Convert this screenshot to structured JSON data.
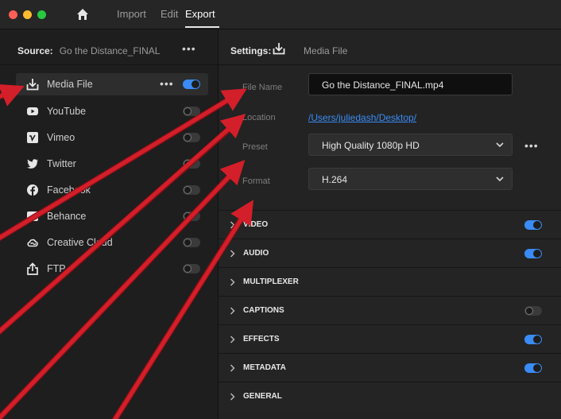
{
  "nav": {
    "tabs": [
      "Import",
      "Edit",
      "Export"
    ]
  },
  "source": {
    "label": "Source:",
    "value": "Go the Distance_FINAL",
    "more": "•••"
  },
  "destinations": [
    {
      "label": "Media File",
      "icon": "download-icon",
      "enabled": true,
      "selected": true,
      "more": "•••"
    },
    {
      "label": "YouTube",
      "icon": "youtube-icon",
      "enabled": false
    },
    {
      "label": "Vimeo",
      "icon": "vimeo-icon",
      "enabled": false
    },
    {
      "label": "Twitter",
      "icon": "twitter-icon",
      "enabled": false
    },
    {
      "label": "Facebook",
      "icon": "facebook-icon",
      "enabled": false
    },
    {
      "label": "Behance",
      "icon": "behance-icon",
      "enabled": false
    },
    {
      "label": "Creative Cloud",
      "icon": "creative-cloud-icon",
      "enabled": false
    },
    {
      "label": "FTP",
      "icon": "upload-icon",
      "enabled": false
    }
  ],
  "settings": {
    "label": "Settings:",
    "value": "Media File",
    "file_name_label": "File Name",
    "file_name": "Go the Distance_FINAL.mp4",
    "location_label": "Location",
    "location": "/Users/juliedash/Desktop/",
    "preset_label": "Preset",
    "preset": "High Quality 1080p HD",
    "preset_more": "•••",
    "format_label": "Format",
    "format": "H.264"
  },
  "sections": [
    {
      "label": "VIDEO",
      "toggle": "on"
    },
    {
      "label": "AUDIO",
      "toggle": "on"
    },
    {
      "label": "MULTIPLEXER",
      "toggle": "none"
    },
    {
      "label": "CAPTIONS",
      "toggle": "off"
    },
    {
      "label": "EFFECTS",
      "toggle": "on"
    },
    {
      "label": "METADATA",
      "toggle": "on"
    },
    {
      "label": "GENERAL",
      "toggle": "none"
    }
  ],
  "colors": {
    "accent": "#3a8bf5",
    "annotation_arrow": "#d31f2a"
  }
}
